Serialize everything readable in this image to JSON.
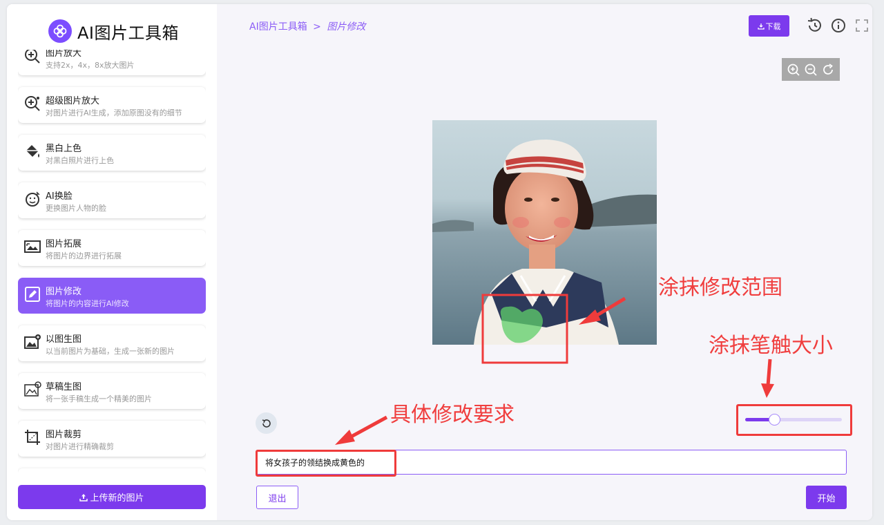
{
  "app": {
    "title": "AI图片工具箱"
  },
  "sidebar": {
    "items": [
      {
        "title": "图片放大",
        "desc": "支持2x，4x，8x放大图片",
        "icon": "zoom-in-icon"
      },
      {
        "title": "超级图片放大",
        "desc": "对图片进行AI生成，添加原图没有的细节",
        "icon": "zoom-plus-icon"
      },
      {
        "title": "黑白上色",
        "desc": "对黑白照片进行上色",
        "icon": "paint-bucket-icon"
      },
      {
        "title": "AI换脸",
        "desc": "更换图片人物的脸",
        "icon": "face-swap-icon"
      },
      {
        "title": "图片拓展",
        "desc": "将图片的边界进行拓展",
        "icon": "image-expand-icon"
      },
      {
        "title": "图片修改",
        "desc": "将图片的内容进行AI修改",
        "icon": "edit-icon",
        "active": true
      },
      {
        "title": "以图生图",
        "desc": "以当前图片为基础，生成一张新的图片",
        "icon": "image-generate-icon"
      },
      {
        "title": "草稿生图",
        "desc": "将一张手稿生成一个精美的图片",
        "icon": "sketch-image-icon"
      },
      {
        "title": "图片裁剪",
        "desc": "对图片进行精确裁剪",
        "icon": "crop-icon"
      }
    ],
    "upload_label": "上传新的图片"
  },
  "header": {
    "breadcrumb_root": "AI图片工具箱",
    "breadcrumb_sep": ">",
    "breadcrumb_current": "图片修改",
    "download_label": "下载"
  },
  "annotations": {
    "area": "涂抹修改范围",
    "brush": "涂抹笔触大小",
    "prompt": "具体修改要求"
  },
  "editor": {
    "brush_size": 0.3,
    "prompt_value": "将女孩子的领结换成黄色的",
    "exit_label": "退出",
    "start_label": "开始"
  },
  "colors": {
    "accent": "#7c3aed",
    "annotation": "#ef3b3b",
    "mask": "#5fcf6a"
  }
}
